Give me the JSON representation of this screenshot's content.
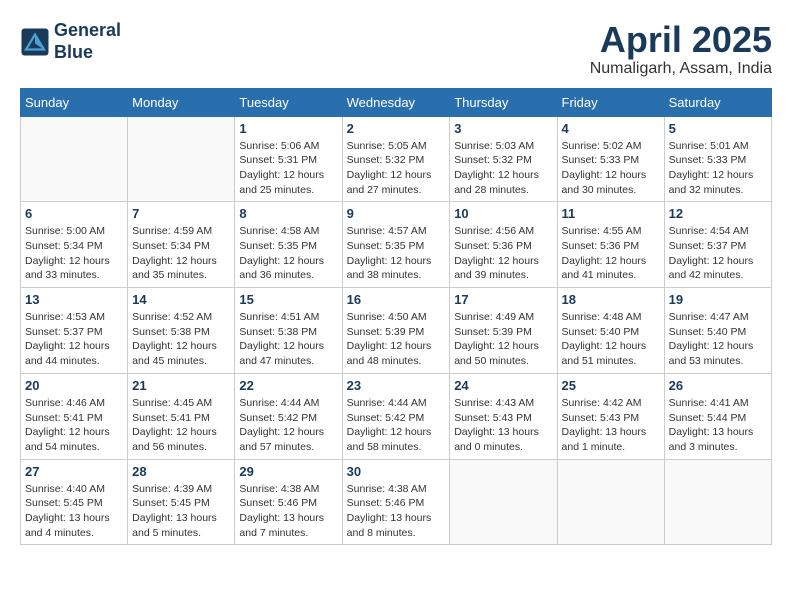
{
  "header": {
    "logo_line1": "General",
    "logo_line2": "Blue",
    "month_title": "April 2025",
    "location": "Numaligarh, Assam, India"
  },
  "weekdays": [
    "Sunday",
    "Monday",
    "Tuesday",
    "Wednesday",
    "Thursday",
    "Friday",
    "Saturday"
  ],
  "weeks": [
    [
      {
        "day": "",
        "info": ""
      },
      {
        "day": "",
        "info": ""
      },
      {
        "day": "1",
        "info": "Sunrise: 5:06 AM\nSunset: 5:31 PM\nDaylight: 12 hours\nand 25 minutes."
      },
      {
        "day": "2",
        "info": "Sunrise: 5:05 AM\nSunset: 5:32 PM\nDaylight: 12 hours\nand 27 minutes."
      },
      {
        "day": "3",
        "info": "Sunrise: 5:03 AM\nSunset: 5:32 PM\nDaylight: 12 hours\nand 28 minutes."
      },
      {
        "day": "4",
        "info": "Sunrise: 5:02 AM\nSunset: 5:33 PM\nDaylight: 12 hours\nand 30 minutes."
      },
      {
        "day": "5",
        "info": "Sunrise: 5:01 AM\nSunset: 5:33 PM\nDaylight: 12 hours\nand 32 minutes."
      }
    ],
    [
      {
        "day": "6",
        "info": "Sunrise: 5:00 AM\nSunset: 5:34 PM\nDaylight: 12 hours\nand 33 minutes."
      },
      {
        "day": "7",
        "info": "Sunrise: 4:59 AM\nSunset: 5:34 PM\nDaylight: 12 hours\nand 35 minutes."
      },
      {
        "day": "8",
        "info": "Sunrise: 4:58 AM\nSunset: 5:35 PM\nDaylight: 12 hours\nand 36 minutes."
      },
      {
        "day": "9",
        "info": "Sunrise: 4:57 AM\nSunset: 5:35 PM\nDaylight: 12 hours\nand 38 minutes."
      },
      {
        "day": "10",
        "info": "Sunrise: 4:56 AM\nSunset: 5:36 PM\nDaylight: 12 hours\nand 39 minutes."
      },
      {
        "day": "11",
        "info": "Sunrise: 4:55 AM\nSunset: 5:36 PM\nDaylight: 12 hours\nand 41 minutes."
      },
      {
        "day": "12",
        "info": "Sunrise: 4:54 AM\nSunset: 5:37 PM\nDaylight: 12 hours\nand 42 minutes."
      }
    ],
    [
      {
        "day": "13",
        "info": "Sunrise: 4:53 AM\nSunset: 5:37 PM\nDaylight: 12 hours\nand 44 minutes."
      },
      {
        "day": "14",
        "info": "Sunrise: 4:52 AM\nSunset: 5:38 PM\nDaylight: 12 hours\nand 45 minutes."
      },
      {
        "day": "15",
        "info": "Sunrise: 4:51 AM\nSunset: 5:38 PM\nDaylight: 12 hours\nand 47 minutes."
      },
      {
        "day": "16",
        "info": "Sunrise: 4:50 AM\nSunset: 5:39 PM\nDaylight: 12 hours\nand 48 minutes."
      },
      {
        "day": "17",
        "info": "Sunrise: 4:49 AM\nSunset: 5:39 PM\nDaylight: 12 hours\nand 50 minutes."
      },
      {
        "day": "18",
        "info": "Sunrise: 4:48 AM\nSunset: 5:40 PM\nDaylight: 12 hours\nand 51 minutes."
      },
      {
        "day": "19",
        "info": "Sunrise: 4:47 AM\nSunset: 5:40 PM\nDaylight: 12 hours\nand 53 minutes."
      }
    ],
    [
      {
        "day": "20",
        "info": "Sunrise: 4:46 AM\nSunset: 5:41 PM\nDaylight: 12 hours\nand 54 minutes."
      },
      {
        "day": "21",
        "info": "Sunrise: 4:45 AM\nSunset: 5:41 PM\nDaylight: 12 hours\nand 56 minutes."
      },
      {
        "day": "22",
        "info": "Sunrise: 4:44 AM\nSunset: 5:42 PM\nDaylight: 12 hours\nand 57 minutes."
      },
      {
        "day": "23",
        "info": "Sunrise: 4:44 AM\nSunset: 5:42 PM\nDaylight: 12 hours\nand 58 minutes."
      },
      {
        "day": "24",
        "info": "Sunrise: 4:43 AM\nSunset: 5:43 PM\nDaylight: 13 hours\nand 0 minutes."
      },
      {
        "day": "25",
        "info": "Sunrise: 4:42 AM\nSunset: 5:43 PM\nDaylight: 13 hours\nand 1 minute."
      },
      {
        "day": "26",
        "info": "Sunrise: 4:41 AM\nSunset: 5:44 PM\nDaylight: 13 hours\nand 3 minutes."
      }
    ],
    [
      {
        "day": "27",
        "info": "Sunrise: 4:40 AM\nSunset: 5:45 PM\nDaylight: 13 hours\nand 4 minutes."
      },
      {
        "day": "28",
        "info": "Sunrise: 4:39 AM\nSunset: 5:45 PM\nDaylight: 13 hours\nand 5 minutes."
      },
      {
        "day": "29",
        "info": "Sunrise: 4:38 AM\nSunset: 5:46 PM\nDaylight: 13 hours\nand 7 minutes."
      },
      {
        "day": "30",
        "info": "Sunrise: 4:38 AM\nSunset: 5:46 PM\nDaylight: 13 hours\nand 8 minutes."
      },
      {
        "day": "",
        "info": ""
      },
      {
        "day": "",
        "info": ""
      },
      {
        "day": "",
        "info": ""
      }
    ]
  ]
}
